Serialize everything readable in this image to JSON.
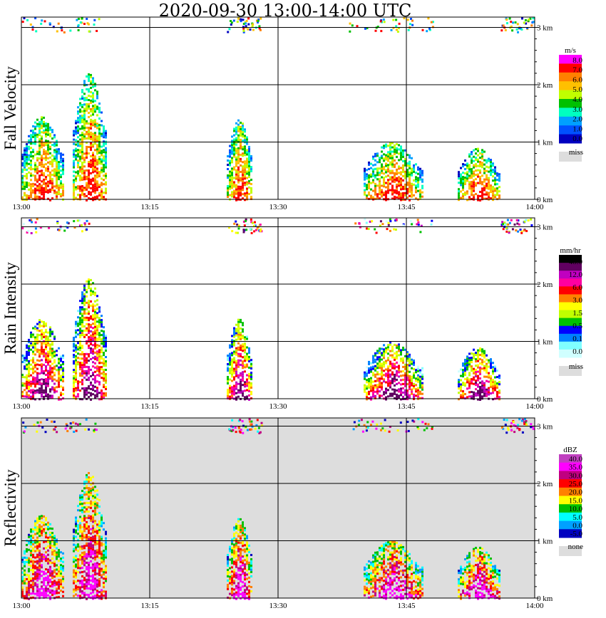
{
  "title": "2020-09-30  13:00-14:00 UTC",
  "x_ticks": [
    "13:00",
    "13:15",
    "13:30",
    "13:45",
    "14:00"
  ],
  "y_ticks": [
    "0 km",
    "1 km",
    "2 km",
    "3 km"
  ],
  "chart_data": [
    {
      "type": "heatmap",
      "panel": "Fall Velocity",
      "ylabel": "Fall Velocity",
      "xlabel": "",
      "x_range": [
        "13:00",
        "14:00"
      ],
      "y_range_km": [
        0,
        3.2
      ],
      "grid": true,
      "background": "#ffffff",
      "legend": {
        "unit": "m/s",
        "placement": "right",
        "levels": [
          "8.0",
          "7.0",
          "6.0",
          "5.0",
          "4.0",
          "3.0",
          "2.0",
          "1.0",
          "0.0"
        ],
        "colors": [
          "#ff00ff",
          "#ff0000",
          "#ff8000",
          "#ffc000",
          "#c0ff00",
          "#00c000",
          "#00ffc0",
          "#00a0ff",
          "#0050ff",
          "#0000c0"
        ],
        "miss_label": "miss",
        "miss_color": "#dddddd"
      },
      "echoes": [
        {
          "t0": "13:00",
          "t1": "13:05",
          "top_km": 1.45,
          "value": 2.0
        },
        {
          "t0": "13:06",
          "t1": "13:10",
          "top_km": 2.2,
          "value": 4.5
        },
        {
          "t0": "13:24",
          "t1": "13:27",
          "top_km": 1.4,
          "value": 4.0
        },
        {
          "t0": "13:40",
          "t1": "13:47",
          "top_km": 1.0,
          "value": 2.0
        },
        {
          "t0": "13:51",
          "t1": "13:56",
          "top_km": 0.9,
          "value": 1.5
        }
      ]
    },
    {
      "type": "heatmap",
      "panel": "Rain Intensity",
      "ylabel": "Rain Intensity",
      "xlabel": "",
      "x_range": [
        "13:00",
        "14:00"
      ],
      "y_range_km": [
        0,
        3.2
      ],
      "grid": true,
      "background": "#ffffff",
      "legend": {
        "unit": "mm/hr",
        "placement": "right",
        "levels": [
          "48.0",
          "12.0",
          "6.0",
          "3.0",
          "1.5",
          "0.5",
          "0.1",
          "0.0"
        ],
        "colors": [
          "#000000",
          "#600060",
          "#c000c0",
          "#ff00a0",
          "#ff0000",
          "#ff8000",
          "#ffff00",
          "#c0ff00",
          "#00c000",
          "#0000ff",
          "#0080ff",
          "#80ffff",
          "#d0ffff"
        ],
        "miss_label": "miss",
        "miss_color": "#dddddd"
      },
      "echoes": [
        {
          "t0": "13:00",
          "t1": "13:05",
          "top_km": 1.4,
          "value": 3.0
        },
        {
          "t0": "13:06",
          "t1": "13:10",
          "top_km": 2.1,
          "value": 6.0
        },
        {
          "t0": "13:24",
          "t1": "13:27",
          "top_km": 1.4,
          "value": 1.5
        },
        {
          "t0": "13:40",
          "t1": "13:47",
          "top_km": 1.0,
          "value": 0.5
        },
        {
          "t0": "13:51",
          "t1": "13:56",
          "top_km": 0.9,
          "value": 0.5
        }
      ]
    },
    {
      "type": "heatmap",
      "panel": "Reflectivity",
      "ylabel": "Reflectivity",
      "xlabel": "",
      "x_range": [
        "13:00",
        "14:00"
      ],
      "y_range_km": [
        0,
        3.2
      ],
      "grid": true,
      "background": "#dddddd",
      "legend": {
        "unit": "dBZ",
        "placement": "right",
        "levels": [
          "40.0",
          "35.0",
          "30.0",
          "25.0",
          "20.0",
          "15.0",
          "10.0",
          "5.0",
          "0.0",
          "-5.0"
        ],
        "colors": [
          "#c040c0",
          "#ff00ff",
          "#c00080",
          "#ff0000",
          "#ff8000",
          "#ffff00",
          "#00c000",
          "#00ffff",
          "#00a0ff",
          "#0000c0"
        ],
        "miss_label": "none",
        "miss_color": "#dddddd"
      },
      "echoes": [
        {
          "t0": "13:00",
          "t1": "13:05",
          "top_km": 1.45,
          "value": 20.0
        },
        {
          "t0": "13:06",
          "t1": "13:10",
          "top_km": 2.2,
          "value": 30.0
        },
        {
          "t0": "13:24",
          "t1": "13:27",
          "top_km": 1.4,
          "value": 15.0
        },
        {
          "t0": "13:40",
          "t1": "13:47",
          "top_km": 1.0,
          "value": 10.0
        },
        {
          "t0": "13:51",
          "t1": "13:56",
          "top_km": 0.9,
          "value": 10.0
        }
      ]
    }
  ]
}
